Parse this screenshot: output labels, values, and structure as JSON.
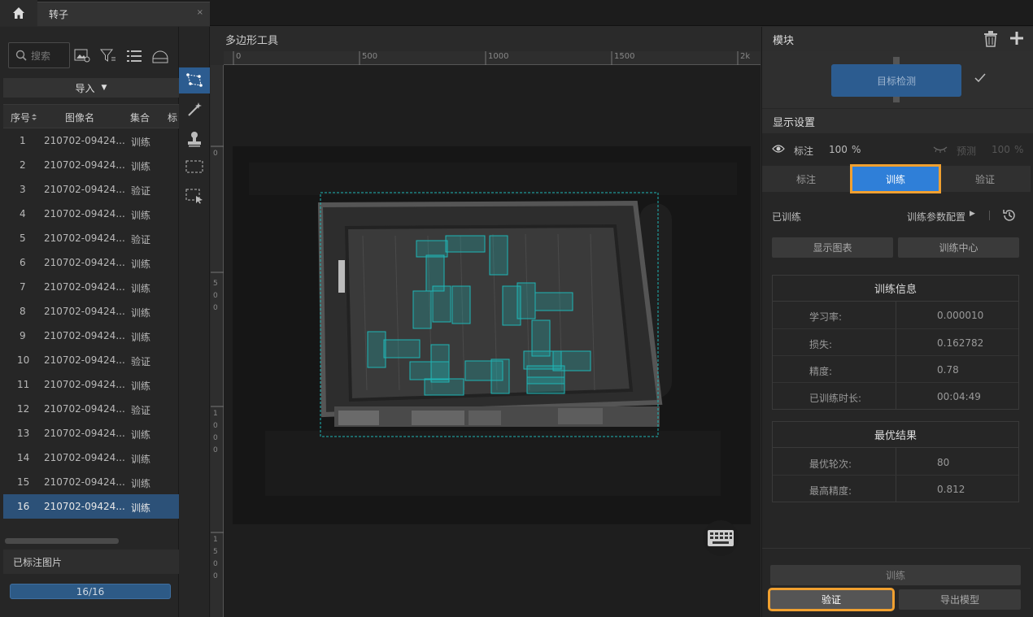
{
  "tab": {
    "title": "转子",
    "close": "×"
  },
  "left": {
    "search_placeholder": "搜索",
    "import_label": "导入",
    "columns": [
      "序号",
      "图像名",
      "集合",
      "标"
    ],
    "rows": [
      {
        "n": "1",
        "name": "210702-09424...",
        "set": "训练"
      },
      {
        "n": "2",
        "name": "210702-09424...",
        "set": "训练"
      },
      {
        "n": "3",
        "name": "210702-09424...",
        "set": "验证"
      },
      {
        "n": "4",
        "name": "210702-09424...",
        "set": "训练"
      },
      {
        "n": "5",
        "name": "210702-09424...",
        "set": "验证"
      },
      {
        "n": "6",
        "name": "210702-09424...",
        "set": "训练"
      },
      {
        "n": "7",
        "name": "210702-09424...",
        "set": "训练"
      },
      {
        "n": "8",
        "name": "210702-09424...",
        "set": "训练"
      },
      {
        "n": "9",
        "name": "210702-09424...",
        "set": "训练"
      },
      {
        "n": "10",
        "name": "210702-09424...",
        "set": "验证"
      },
      {
        "n": "11",
        "name": "210702-09424...",
        "set": "训练"
      },
      {
        "n": "12",
        "name": "210702-09424...",
        "set": "验证"
      },
      {
        "n": "13",
        "name": "210702-09424...",
        "set": "训练"
      },
      {
        "n": "14",
        "name": "210702-09424...",
        "set": "训练"
      },
      {
        "n": "15",
        "name": "210702-09424...",
        "set": "训练"
      },
      {
        "n": "16",
        "name": "210702-09424...",
        "set": "训练"
      }
    ],
    "annotated_label": "已标注图片",
    "progress_text": "16/16",
    "progress_fraction": 1.0
  },
  "canvas": {
    "title": "多边形工具",
    "ruler_top": [
      "0",
      "500",
      "1000",
      "1500",
      "2k"
    ],
    "ruler_left": [
      "0",
      "5",
      "0",
      "0",
      "1",
      "0",
      "0",
      "0",
      "1",
      "5",
      "0",
      "0"
    ]
  },
  "right": {
    "module_title": "模块",
    "module_node": "目标检测",
    "display_title": "显示设置",
    "annot_label": "标注",
    "annot_pct": "100",
    "pred_label": "预测",
    "pred_pct": "100",
    "pct_sign": "%",
    "tabs": [
      "标注",
      "训练",
      "验证"
    ],
    "trained_label": "已训练",
    "param_label": "训练参数配置",
    "show_chart": "显示图表",
    "train_center": "训练中心",
    "info_title": "训练信息",
    "info": [
      {
        "k": "学习率:",
        "v": "0.000010"
      },
      {
        "k": "损失:",
        "v": "0.162782"
      },
      {
        "k": "精度:",
        "v": "0.78"
      },
      {
        "k": "已训练时长:",
        "v": "00:04:49"
      }
    ],
    "best_title": "最优结果",
    "best": [
      {
        "k": "最优轮次:",
        "v": "80"
      },
      {
        "k": "最高精度:",
        "v": "0.812"
      }
    ],
    "train_btn": "训练",
    "verify_btn": "验证",
    "export_btn": "导出模型"
  },
  "colors": {
    "accent": "#2f7fd8",
    "highlight": "#f0a030",
    "box": "#1fb5b5"
  }
}
